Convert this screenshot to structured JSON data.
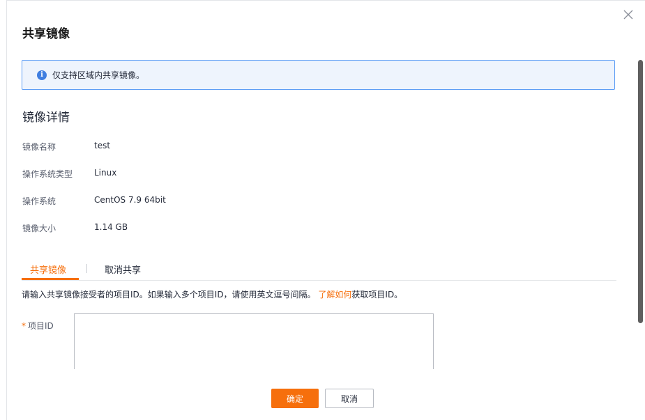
{
  "dialog": {
    "title": "共享镜像",
    "notice": "仅支持区域内共享镜像。",
    "section_title": "镜像详情",
    "details": [
      {
        "label": "镜像名称",
        "value": "test"
      },
      {
        "label": "操作系统类型",
        "value": "Linux"
      },
      {
        "label": "操作系统",
        "value": "CentOS 7.9 64bit"
      },
      {
        "label": "镜像大小",
        "value": "1.14 GB"
      }
    ],
    "tabs": [
      {
        "label": "共享镜像",
        "active": true
      },
      {
        "label": "取消共享",
        "active": false
      }
    ],
    "hint_prefix": "请输入共享镜像接受者的项目ID。如果输入多个项目ID，请使用英文逗号间隔。",
    "hint_link": "了解如何",
    "hint_suffix": "获取项目ID。",
    "field_required_mark": "*",
    "field_label": "项目ID",
    "field_value": "",
    "confirm_label": "确定",
    "cancel_label": "取消"
  },
  "icons": {
    "close": "close-icon",
    "info": "info-icon"
  },
  "colors": {
    "accent": "#f66f0c",
    "notice_bg": "#eef4fd",
    "notice_border": "#5e9ef5",
    "info_icon": "#3f7ee0"
  }
}
